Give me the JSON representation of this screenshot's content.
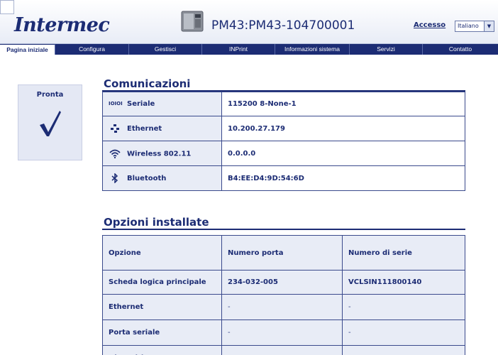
{
  "header": {
    "logo": "Intermec",
    "device_title": "PM43:PM43-104700001",
    "login_link": "Accesso",
    "language": {
      "selected": "Italiano"
    }
  },
  "nav": {
    "items": [
      {
        "label": "Pagina iniziale",
        "active": true
      },
      {
        "label": "Configura",
        "active": false
      },
      {
        "label": "Gestisci",
        "active": false
      },
      {
        "label": "INPrint",
        "active": false
      },
      {
        "label": "Informazioni sistema",
        "active": false
      },
      {
        "label": "Servizi",
        "active": false
      },
      {
        "label": "Contatto",
        "active": false
      }
    ]
  },
  "status": {
    "label": "Pronta",
    "icon": "checkmark-icon"
  },
  "communications": {
    "title": "Comunicazioni",
    "rows": [
      {
        "icon_text": "IOIOI",
        "icon": "serial-icon",
        "label": "Seriale",
        "value": "115200 8-None-1"
      },
      {
        "icon": "ethernet-icon",
        "label": "Ethernet",
        "value": "10.200.27.179"
      },
      {
        "icon": "wifi-icon",
        "label": "Wireless 802.11",
        "value": "0.0.0.0"
      },
      {
        "icon": "bluetooth-icon",
        "label": "Bluetooth",
        "value": "B4:EE:D4:9D:54:6D"
      }
    ]
  },
  "installed_options": {
    "title": "Opzioni installate",
    "headers": [
      "Opzione",
      "Numero porta",
      "Numero di serie"
    ],
    "rows": [
      [
        "Scheda logica principale",
        "234-032-005",
        "VCLSIN111800140"
      ],
      [
        "Ethernet",
        "-",
        "-"
      ],
      [
        "Porta seriale",
        "-",
        "-"
      ],
      [
        "Dispositivo USB",
        "-",
        "-"
      ]
    ]
  },
  "colors": {
    "brand": "#1c2c74",
    "panel": "#e8ecf6"
  }
}
